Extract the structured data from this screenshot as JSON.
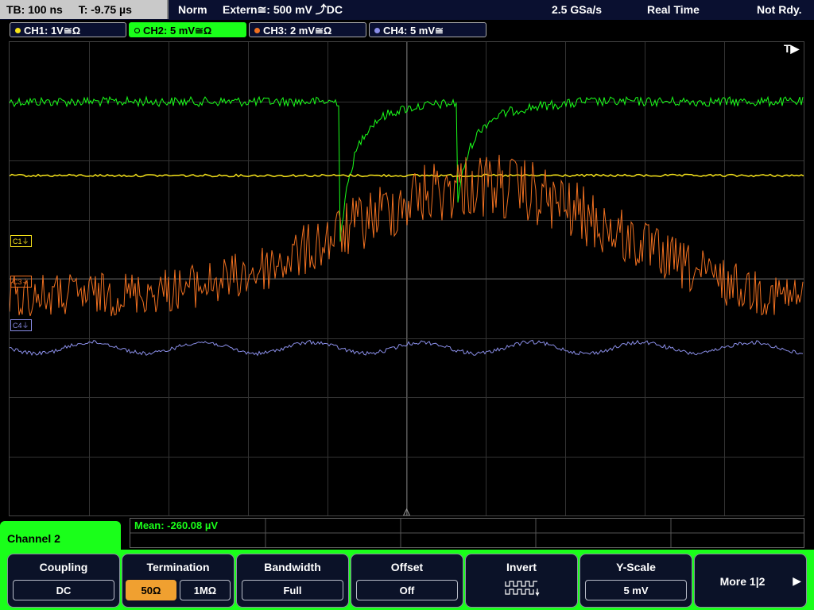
{
  "status": {
    "timebase": "TB: 100 ns",
    "trigger_time": "T: -9.75 µs",
    "mode": "Norm",
    "trigger_source": "Extern≅: 500 mV ⤴DC",
    "sample_rate": "2.5 GSa/s",
    "acq_mode": "Real Time",
    "state": "Not Rdy."
  },
  "channels": [
    {
      "label": "CH1: 1V≅Ω",
      "color": "#f5e21a"
    },
    {
      "label": "CH2: 5 mV≅Ω",
      "color": "#1aff1a"
    },
    {
      "label": "CH3: 2 mV≅Ω",
      "color": "#f07020"
    },
    {
      "label": "CH4: 5 mV≅",
      "color": "#8a8ee8"
    }
  ],
  "markers": {
    "trigger_pos": "T▶",
    "c1": "C1⏚",
    "c3": "C3⏚",
    "c4": "C4⏚"
  },
  "measurement": "Mean: -260.08 µV",
  "menu": {
    "channel_title": "Channel 2",
    "coupling": {
      "title": "Coupling",
      "value": "DC"
    },
    "termination": {
      "title": "Termination",
      "opt1": "50Ω",
      "opt2": "1MΩ",
      "selected": "50Ω"
    },
    "bandwidth": {
      "title": "Bandwidth",
      "value": "Full"
    },
    "offset": {
      "title": "Offset",
      "value": "Off"
    },
    "invert": {
      "title": "Invert",
      "icon": "invert-waveform-icon"
    },
    "yscale": {
      "title": "Y-Scale",
      "value": "5 mV"
    },
    "more": {
      "label": "More 1|2"
    }
  }
}
